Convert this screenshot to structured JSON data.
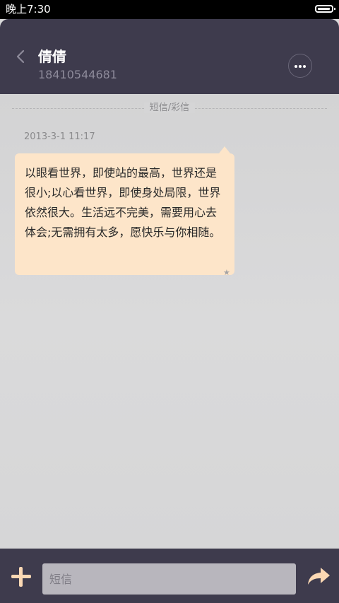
{
  "status_bar": {
    "time": "晚上7:30",
    "battery_icon": "battery-icon"
  },
  "header": {
    "back_icon": "chevron-left-icon",
    "contact_name": "倩倩",
    "contact_number": "18410544681",
    "more_icon": "more-dots-icon"
  },
  "conversation": {
    "divider_label": "短信/彩信",
    "messages": [
      {
        "timestamp": "2013-3-1 11:17",
        "text": "以眼看世界，即使站的最高，世界还是很小;以心看世界，即使身处局限，世界依然很大。生活远不完美，需要用心去体会;无需拥有太多，愿快乐与你相随。",
        "starred_icon": "star-icon",
        "star_glyph": "★"
      }
    ]
  },
  "compose": {
    "add_icon": "plus-icon",
    "input_placeholder": "短信",
    "input_value": "",
    "send_icon": "send-arrow-icon"
  },
  "colors": {
    "header_bg": "#3e3b4d",
    "bubble_bg": "#fde5c9",
    "accent": "#fbd8b4",
    "content_bg": "#d8d8d9"
  }
}
